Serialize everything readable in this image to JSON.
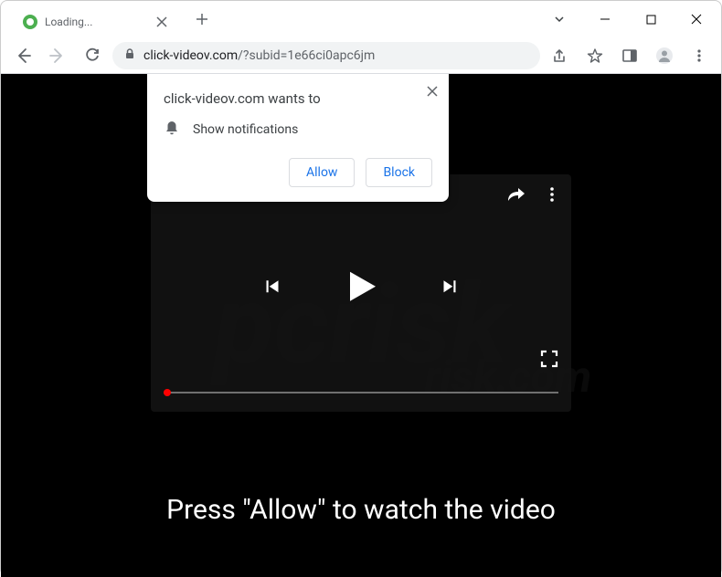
{
  "tab": {
    "title": "Loading...",
    "favicon_color": "#4caf50"
  },
  "toolbar": {
    "url_host": "click-videov.com",
    "url_path": "/?subid=1e66ci0apc6jm"
  },
  "prompt": {
    "title": "click-videov.com wants to",
    "permission_label": "Show notifications",
    "allow_label": "Allow",
    "block_label": "Block"
  },
  "page": {
    "caption": "Press \"Allow\" to watch the video"
  },
  "watermark": {
    "main": "pcrisk",
    "sub": "risk.com"
  },
  "icons": {
    "close": "✕",
    "plus": "+",
    "chevron_down": "⌄",
    "minimize": "—",
    "maximize": "□"
  }
}
